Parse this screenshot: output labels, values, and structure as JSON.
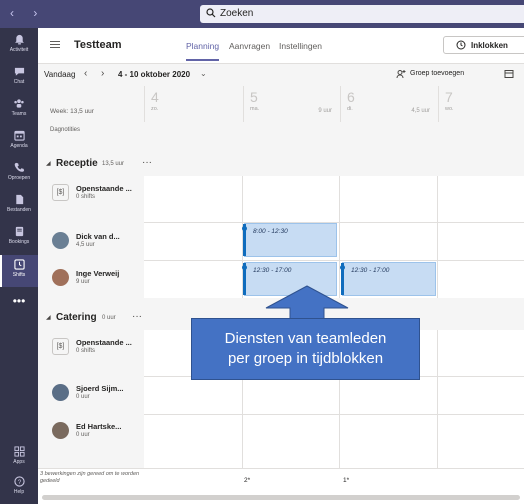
{
  "search": {
    "placeholder": "Zoeken"
  },
  "rail": {
    "items": [
      {
        "label": "Activiteit",
        "icon": "bell-icon"
      },
      {
        "label": "Chat",
        "icon": "chat-icon"
      },
      {
        "label": "Teams",
        "icon": "teams-icon"
      },
      {
        "label": "Agenda",
        "icon": "calendar-icon"
      },
      {
        "label": "Oproepen",
        "icon": "phone-icon"
      },
      {
        "label": "Bestanden",
        "icon": "file-icon"
      },
      {
        "label": "Bookings",
        "icon": "bookings-icon"
      },
      {
        "label": "Shifts",
        "icon": "shifts-icon",
        "active": true
      },
      {
        "label": "Apps",
        "icon": "apps-icon"
      },
      {
        "label": "Help",
        "icon": "help-icon"
      }
    ]
  },
  "header": {
    "team": "Testteam",
    "tabs": [
      "Planning",
      "Aanvragen",
      "Instellingen"
    ],
    "active_tab": "Planning",
    "clock_button": "Inklokken"
  },
  "toolbar": {
    "today": "Vandaag",
    "date_range": "4 - 10 oktober 2020",
    "add_group": "Groep toevoegen"
  },
  "week": {
    "label": "Week: 13,5 uur",
    "notes_label": "Dagnotities",
    "days": [
      {
        "num": "4",
        "name": "zo.",
        "hours": ""
      },
      {
        "num": "5",
        "name": "ma.",
        "hours": "9 uur"
      },
      {
        "num": "6",
        "name": "di.",
        "hours": "4,5 uur"
      },
      {
        "num": "7",
        "name": "wo.",
        "hours": ""
      }
    ]
  },
  "groups": {
    "receptie": {
      "name": "Receptie",
      "hours": "13,5 uur",
      "open": {
        "name": "Openstaande ...",
        "sub": "0 shifts"
      },
      "members": [
        {
          "name": "Dick van d...",
          "sub": "4,5 uur",
          "avatar_color": "#6a7f94"
        },
        {
          "name": "Inge Verweij",
          "sub": "9 uur",
          "avatar_color": "#a0705a"
        }
      ],
      "shifts": [
        {
          "time": "8:00 - 12:30"
        },
        {
          "time": "12:30 - 17:00"
        },
        {
          "time": "12:30 - 17:00"
        }
      ]
    },
    "catering": {
      "name": "Catering",
      "hours": "0 uur",
      "open": {
        "name": "Openstaande ...",
        "sub": "0 shifts"
      },
      "members": [
        {
          "name": "Sjoerd Sijm...",
          "sub": "0 uur",
          "avatar_color": "#5a6e86"
        },
        {
          "name": "Ed Hartske...",
          "sub": "0 uur",
          "avatar_color": "#7a6a5e"
        }
      ]
    }
  },
  "footer": {
    "note": "3 bewerkingen zijn gereed om te worden gedeeld",
    "day5": "2*",
    "day6": "1*"
  },
  "callout": {
    "line1": "Diensten van teamleden",
    "line2": "per groep in tijdblokken"
  },
  "colors": {
    "accent": "#6264a7",
    "rail": "#33344a",
    "topbar": "#464775",
    "shift": "#c7dcf3",
    "callout": "#4472c4"
  }
}
